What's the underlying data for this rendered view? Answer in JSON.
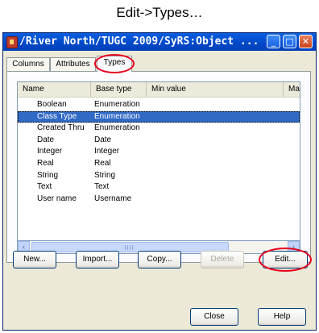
{
  "caption": "Edit->Types…",
  "window": {
    "title": "/River North/TUGC  2009/SyRS:Object ...",
    "controls": {
      "minimize": "_",
      "maximize": "□",
      "close": "✕"
    }
  },
  "tabs": [
    {
      "label": "Columns"
    },
    {
      "label": "Attributes"
    },
    {
      "label": "Types"
    }
  ],
  "table": {
    "columns": [
      "Name",
      "Base type",
      "Min value",
      "Ma"
    ],
    "rows": [
      {
        "name": "Boolean",
        "base": "Enumeration"
      },
      {
        "name": "Class Type",
        "base": "Enumeration"
      },
      {
        "name": "Created Thru",
        "base": "Enumeration"
      },
      {
        "name": "Date",
        "base": "Date"
      },
      {
        "name": "Integer",
        "base": "Integer"
      },
      {
        "name": "Real",
        "base": "Real"
      },
      {
        "name": "String",
        "base": "String"
      },
      {
        "name": "Text",
        "base": "Text"
      },
      {
        "name": "User name",
        "base": "Username"
      }
    ],
    "selected_row": "Class Type"
  },
  "scrollbar": {
    "left_icon": "‹",
    "right_icon": "›",
    "grip": "III"
  },
  "buttons": {
    "new": "New...",
    "import": "Import...",
    "copy": "Copy...",
    "delete": "Delete",
    "edit": "Edit...",
    "close": "Close",
    "help": "Help"
  },
  "colors": {
    "highlight_red": "#e8001c",
    "selection_blue": "#316ac5",
    "titlebar_blue": "#0047c8"
  }
}
